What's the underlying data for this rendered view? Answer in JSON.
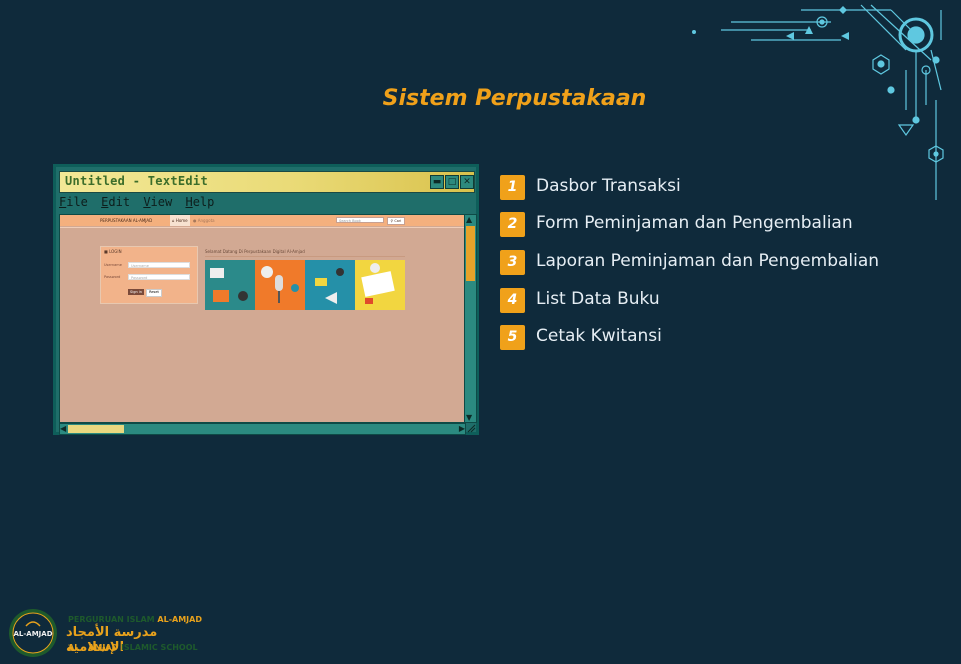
{
  "slide": {
    "title": "Sistem Perpustakaan"
  },
  "window": {
    "title": "Untitled - TextEdit",
    "menu": [
      {
        "first": "F",
        "rest": "ile"
      },
      {
        "first": "E",
        "rest": "dit"
      },
      {
        "first": "V",
        "rest": "iew"
      },
      {
        "first": "H",
        "rest": "elp"
      }
    ],
    "buttons": [
      "minimize-icon",
      "maximize-icon",
      "close-icon"
    ]
  },
  "site": {
    "brand": "PERPUSTAKAAN AL-AMJAD",
    "home_tab": "Home",
    "tab2": "Anggota",
    "search_placeholder": "Search Book",
    "search_button": "Cari",
    "login": {
      "heading": "LOGIN",
      "username_label": "Username",
      "username_placeholder": "Username",
      "password_label": "Password",
      "password_placeholder": "Password",
      "signin": "Sign in",
      "reset": "Reset"
    },
    "welcome": "Selamat Datang Di Perpustakaan Digital Al-Amjad"
  },
  "features": [
    {
      "num": "1",
      "label": "Dasbor Transaksi"
    },
    {
      "num": "2",
      "label": "Form Peminjaman dan Pengembalian"
    },
    {
      "num": "3",
      "label": "Laporan Peminjaman dan Pengembalian"
    },
    {
      "num": "4",
      "label": "List Data Buku"
    },
    {
      "num": "5",
      "label": "Cetak Kwitansi"
    }
  ],
  "footer": {
    "logo_text": "AL-AMJAD",
    "line1_a": "PERGURUAN ISLAM ",
    "line1_b": "AL-AMJAD",
    "line2": "مدرسة الأمجاد الإسلامية",
    "line3_a": "AL - AMJAD ",
    "line3_b": "ISLAMIC SCHOOL"
  },
  "colors": {
    "background": "#0f2a3b",
    "accent": "#f0a11a",
    "window_frame": "#1f6e6a"
  }
}
